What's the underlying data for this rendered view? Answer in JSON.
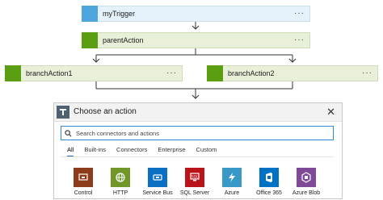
{
  "flow": {
    "trigger": {
      "label": "myTrigger",
      "more": "···"
    },
    "parent": {
      "label": "parentAction",
      "more": "···"
    },
    "branch1": {
      "label": "branchAction1",
      "more": "···"
    },
    "branch2": {
      "label": "branchAction2",
      "more": "···"
    }
  },
  "panel": {
    "title": "Choose an action",
    "close": "✕",
    "search_placeholder": "Search connectors and actions",
    "tabs": [
      "All",
      "Built-ins",
      "Connectors",
      "Enterprise",
      "Custom"
    ],
    "active_tab": "All",
    "connectors": [
      {
        "name": "Control",
        "icon": "control-icon",
        "color": "#8c3c1b"
      },
      {
        "name": "HTTP",
        "icon": "http-icon",
        "color": "#709727"
      },
      {
        "name": "Service Bus",
        "icon": "service-bus-icon",
        "color": "#0b6fc4"
      },
      {
        "name": "SQL Server",
        "icon": "sql-server-icon",
        "color": "#ba141a"
      },
      {
        "name": "Azure",
        "icon": "azure-functions-icon",
        "color": "#3999c6"
      },
      {
        "name": "Office 365",
        "icon": "office-365-icon",
        "color": "#0072c6"
      },
      {
        "name": "Azure Blob",
        "icon": "azure-blob-icon",
        "color": "#804998"
      }
    ]
  },
  "colors": {
    "trigger_accent": "#4ea4dc",
    "action_accent": "#5c9e12",
    "trigger_bg": "#e6f2fb",
    "action_bg": "#e8f0d9",
    "search_border": "#2b88d8"
  }
}
